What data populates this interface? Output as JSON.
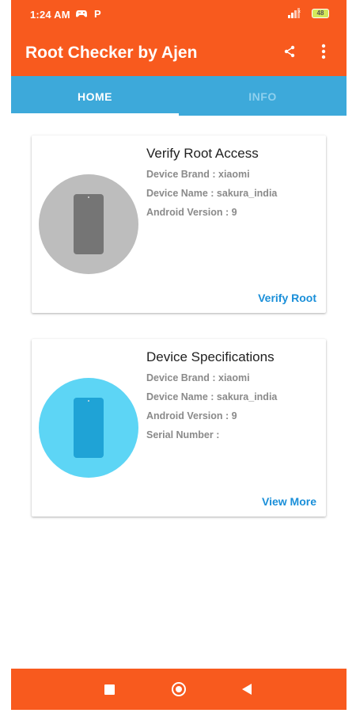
{
  "status_bar": {
    "time": "1:24 AM",
    "notification_icons": [
      "game-controller-icon",
      "p-icon"
    ],
    "notification_text": "P",
    "battery": "48"
  },
  "app_bar": {
    "title": "Root Checker by Ajen",
    "actions": [
      "share-icon",
      "more-vert-icon"
    ]
  },
  "tabs": [
    {
      "label": "HOME",
      "selected": true
    },
    {
      "label": "INFO",
      "selected": false
    }
  ],
  "cards": [
    {
      "title": "Verify Root Access",
      "lines": [
        "Device Brand : xiaomi",
        "Device Name : sakura_india",
        "Android Version : 9"
      ],
      "action": "Verify Root",
      "circle_color": "#BDBDBD"
    },
    {
      "title": "Device Specifications",
      "lines": [
        "Device Brand : xiaomi",
        "Device Name : sakura_india",
        "Android Version : 9",
        "Serial Number :"
      ],
      "action": "View More",
      "circle_color": "#5DD5F5"
    }
  ],
  "colors": {
    "primary": "#F85A1E",
    "tab_bar": "#3DA9DA",
    "accent": "#1A8FD9"
  },
  "nav_bar": {
    "buttons": [
      "recents-square-icon",
      "home-circle-icon",
      "back-triangle-icon"
    ]
  }
}
